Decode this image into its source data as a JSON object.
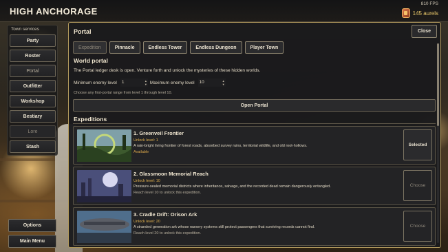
{
  "header": {
    "town_name": "HIGH ANCHORAGE",
    "fps": "810 FPS",
    "currency": "145 aurels",
    "currency_icon": "aurel-coin-icon"
  },
  "sidebar": {
    "title": "Town services",
    "items": [
      {
        "label": "Party",
        "state": "enabled"
      },
      {
        "label": "Roster",
        "state": "enabled"
      },
      {
        "label": "Portal",
        "state": "active"
      },
      {
        "label": "Outfitter",
        "state": "enabled"
      },
      {
        "label": "Workshop",
        "state": "enabled"
      },
      {
        "label": "Bestiary",
        "state": "enabled"
      },
      {
        "label": "Lore",
        "state": "disabled"
      },
      {
        "label": "Stash",
        "state": "enabled"
      }
    ],
    "options_label": "Options",
    "main_menu_label": "Main Menu"
  },
  "panel": {
    "title": "Portal",
    "close_label": "Close",
    "tabs": [
      {
        "label": "Expedition",
        "current": true
      },
      {
        "label": "Pinnacle",
        "current": false
      },
      {
        "label": "Endless Tower",
        "current": false
      },
      {
        "label": "Endless Dungeon",
        "current": false
      },
      {
        "label": "Player Town",
        "current": false
      }
    ],
    "world_portal": {
      "heading": "World portal",
      "description": "The Portal ledger desk is open. Venture forth and unlock the mysteries of these hidden worlds.",
      "min_label": "Minimum enemy level",
      "min_value": "1",
      "max_label": "Maximum enemy level",
      "max_value": "10",
      "hint": "Choose any first-portal range from level 1 through level 10.",
      "open_label": "Open Portal"
    },
    "expeditions_heading": "Expeditions",
    "expeditions": [
      {
        "name": "1. Greenveil Frontier",
        "unlock": "Unlock level: 1",
        "description": "A rain-bright living frontier of forest roads, absorbed survey ruins, territorial wildlife, and old root-hollows.",
        "status": "Available",
        "button": "Selected",
        "selected": true
      },
      {
        "name": "2. Glassmoon Memorial Reach",
        "unlock": "Unlock level: 10",
        "description": "Pressure-sealed memorial districts where inheritance, salvage, and the recorded dead remain dangerously entangled.",
        "status": "Reach level 10 to unlock this expedition.",
        "button": "Choose",
        "selected": false
      },
      {
        "name": "3. Cradle Drift: Orison Ark",
        "unlock": "Unlock level: 20",
        "description": "A stranded generation ark whose nursery systems still protect passengers that surviving records cannot find.",
        "status": "Reach level 20 to unlock this expedition.",
        "button": "Choose",
        "selected": false
      }
    ]
  },
  "colors": {
    "accent_gold": "#b29a5c",
    "unlock_text": "#e2b24e",
    "panel_bg": "#1a1a1c"
  }
}
